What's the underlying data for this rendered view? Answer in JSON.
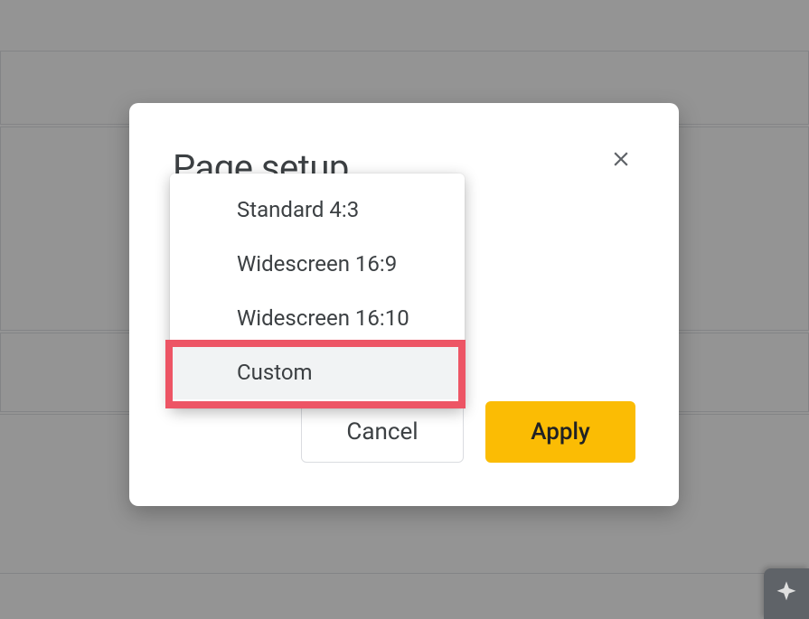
{
  "dialog": {
    "title": "Page setup",
    "cancel_label": "Cancel",
    "apply_label": "Apply"
  },
  "dropdown": {
    "options": [
      "Standard 4:3",
      "Widescreen 16:9",
      "Widescreen 16:10",
      "Custom"
    ]
  }
}
